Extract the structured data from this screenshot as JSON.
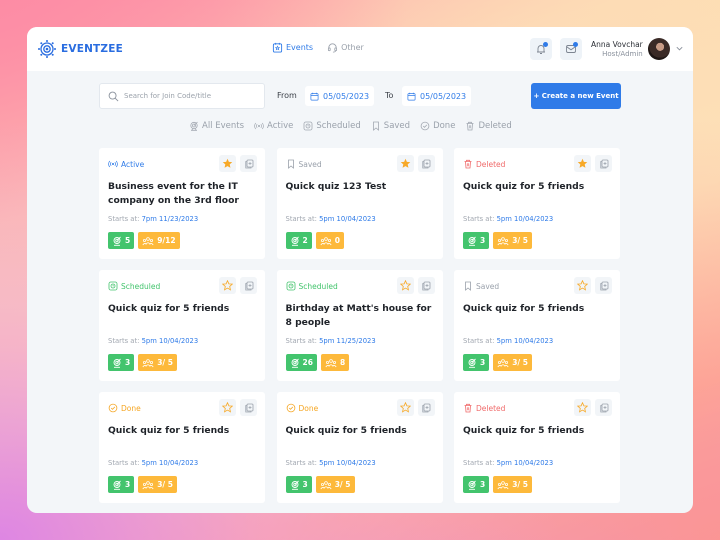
{
  "colors": {
    "primary": "#2f7be8",
    "active": "#2f7be8",
    "saved": "#9aa1ab",
    "deleted": "#f06b6b",
    "scheduled": "#43c46d",
    "done": "#f5a623",
    "star_filled": "#f7a928",
    "badge_green": "#43c46d",
    "badge_orange": "#fdb93b"
  },
  "header": {
    "brand": "EVENTZEE",
    "nav": [
      {
        "label": "Events",
        "icon": "calendar-star-icon",
        "active": true
      },
      {
        "label": "Other",
        "icon": "headset-icon",
        "active": false
      }
    ],
    "notifications_icon": "bell-icon",
    "messages_icon": "mail-icon",
    "user": {
      "name": "Anna Vovchar",
      "role": "Host/Admin"
    }
  },
  "toolbar": {
    "search_placeholder": "Search for Join Code/title",
    "search_value": "",
    "from_label": "From",
    "from_date": "05/05/2023",
    "to_label": "To",
    "to_date": "05/05/2023",
    "create_label": "+ Create a new Event"
  },
  "filters": [
    {
      "label": "All Events",
      "icon": "target-icon"
    },
    {
      "label": "Active",
      "icon": "broadcast-icon"
    },
    {
      "label": "Scheduled",
      "icon": "scheduled-icon"
    },
    {
      "label": "Saved",
      "icon": "bookmark-icon"
    },
    {
      "label": "Done",
      "icon": "check-circle-icon"
    },
    {
      "label": "Deleted",
      "icon": "trash-icon"
    }
  ],
  "starts_label": "Starts at:",
  "events": [
    {
      "status": "Active",
      "title": "Business event for the IT company on the 3rd floor",
      "start": "7pm 11/23/2023",
      "questions": "5",
      "participants": "9/12",
      "starred": true
    },
    {
      "status": "Saved",
      "title": "Quick quiz 123 Test",
      "start": "5pm 10/04/2023",
      "questions": "2",
      "participants": "0",
      "starred": true
    },
    {
      "status": "Deleted",
      "title": "Quick quiz for 5 friends",
      "start": "5pm 10/04/2023",
      "questions": "3",
      "participants": "3/ 5",
      "starred": true
    },
    {
      "status": "Scheduled",
      "title": "Quick quiz for 5 friends",
      "start": "5pm 10/04/2023",
      "questions": "3",
      "participants": "3/ 5",
      "starred": false
    },
    {
      "status": "Scheduled",
      "title": "Birthday at Matt's house for 8 people",
      "start": "5pm 11/25/2023",
      "questions": "26",
      "participants": "8",
      "starred": false
    },
    {
      "status": "Saved",
      "title": "Quick quiz for 5 friends",
      "start": "5pm 10/04/2023",
      "questions": "3",
      "participants": "3/ 5",
      "starred": false
    },
    {
      "status": "Done",
      "title": "Quick quiz for 5 friends",
      "start": "5pm 10/04/2023",
      "questions": "3",
      "participants": "3/ 5",
      "starred": false
    },
    {
      "status": "Done",
      "title": "Quick quiz for 5 friends",
      "start": "5pm 10/04/2023",
      "questions": "3",
      "participants": "3/ 5",
      "starred": false
    },
    {
      "status": "Deleted",
      "title": "Quick quiz for 5 friends",
      "start": "5pm 10/04/2023",
      "questions": "3",
      "participants": "3/ 5",
      "starred": false
    }
  ]
}
